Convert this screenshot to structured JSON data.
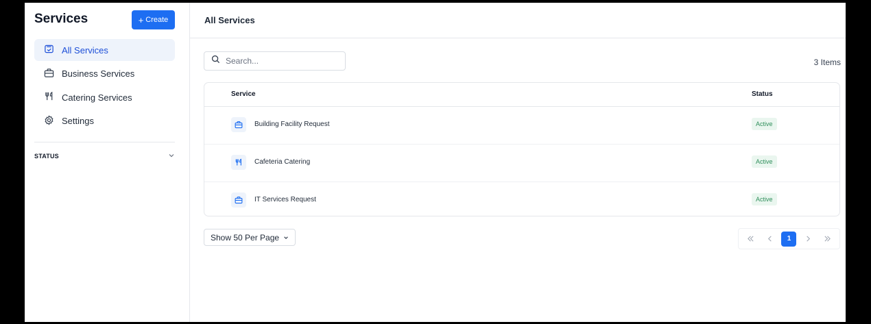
{
  "sidebar": {
    "title": "Services",
    "create_label": "Create",
    "items": [
      {
        "label": "All Services",
        "icon": "all-services-icon"
      },
      {
        "label": "Business Services",
        "icon": "briefcase-icon"
      },
      {
        "label": "Catering Services",
        "icon": "fork-knife-icon"
      },
      {
        "label": "Settings",
        "icon": "gear-icon"
      }
    ],
    "status_filter": "STATUS"
  },
  "main": {
    "title": "All Services",
    "search_placeholder": "Search...",
    "item_count": "3 Items",
    "columns": {
      "service": "Service",
      "status": "Status"
    },
    "rows": [
      {
        "name": "Building Facility Request",
        "status": "Active",
        "icon": "briefcase-icon"
      },
      {
        "name": "Cafeteria Catering",
        "status": "Active",
        "icon": "fork-knife-icon"
      },
      {
        "name": "IT Services Request",
        "status": "Active",
        "icon": "briefcase-icon"
      }
    ],
    "per_page": "Show 50 Per Page",
    "pagination": {
      "current_page": "1"
    }
  },
  "colors": {
    "accent": "#1d6ef2",
    "active_badge_bg": "#eaf6ef",
    "active_badge_text": "#2f8f5b"
  }
}
